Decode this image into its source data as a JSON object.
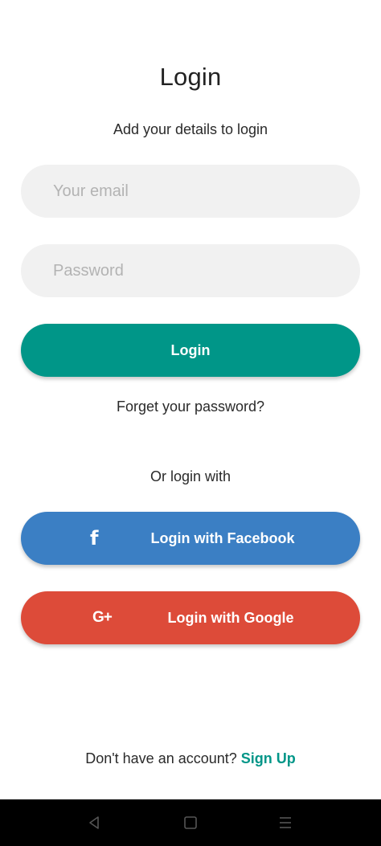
{
  "page": {
    "title": "Login",
    "subtitle": "Add your details to login"
  },
  "form": {
    "email_placeholder": "Your email",
    "email_value": "",
    "password_placeholder": "Password",
    "password_value": "",
    "login_label": "Login",
    "forgot_label": "Forget your password?"
  },
  "social": {
    "heading": "Or login with",
    "facebook": {
      "icon": "f",
      "icon_name": "facebook-icon",
      "label": "Login with Facebook",
      "color": "#3b7fc4"
    },
    "google": {
      "icon": "G+",
      "icon_name": "google-plus-icon",
      "label": "Login with Google",
      "color": "#dd4b39"
    }
  },
  "footer": {
    "prompt": "Don't have an account?",
    "signup_label": "Sign Up"
  },
  "nav_bar": {
    "buttons": [
      "back-icon",
      "home-icon",
      "menu-icon"
    ]
  },
  "colors": {
    "accent": "#009688",
    "field_bg": "#f1f1f1",
    "placeholder": "#b3b3b3",
    "nav_bg": "#000000",
    "nav_icon": "#555555"
  }
}
